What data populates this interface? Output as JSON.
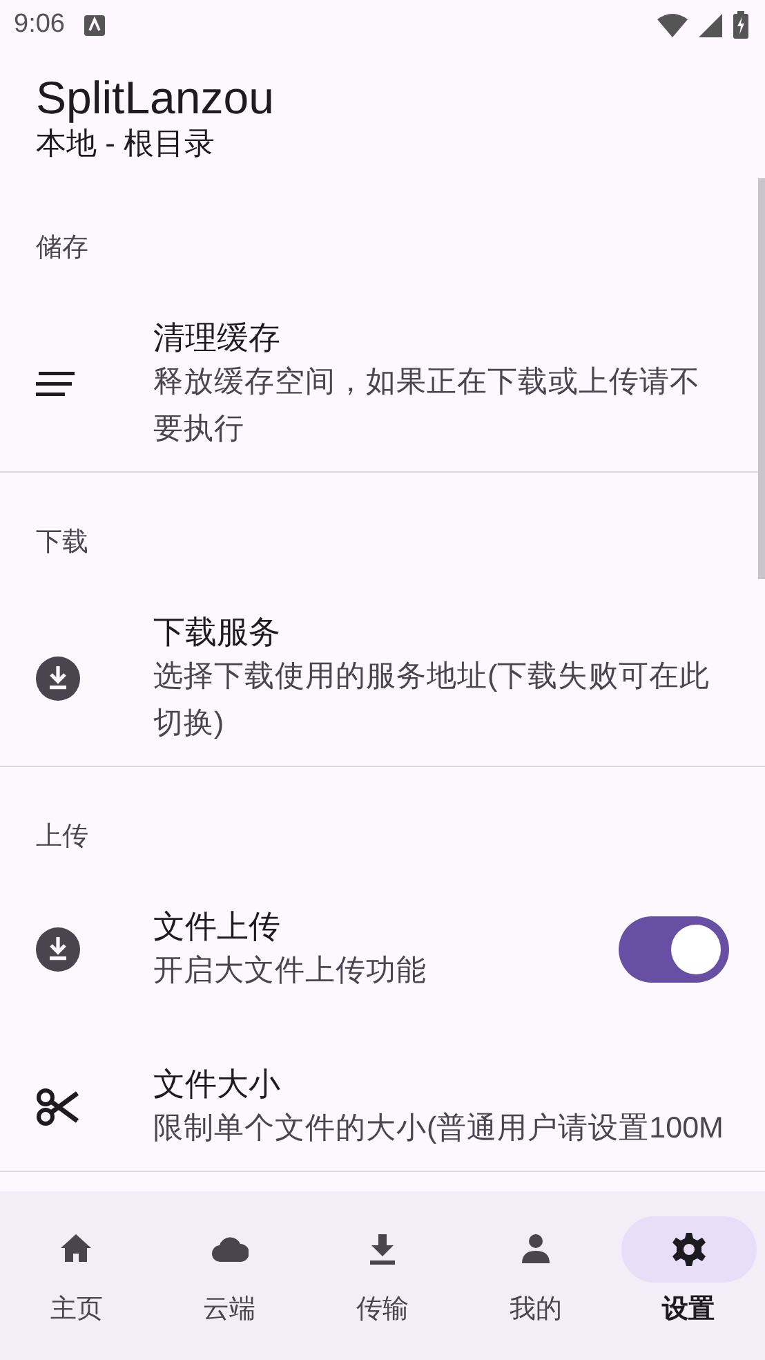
{
  "status_bar": {
    "time": "9:06"
  },
  "app_bar": {
    "title": "SplitLanzou",
    "subtitle": "本地 - 根目录"
  },
  "sections": [
    {
      "label": "储存",
      "items": [
        {
          "kind": "plain",
          "title": "清理缓存",
          "summary": "释放缓存空间，如果正在下载或上传请不要执行"
        }
      ]
    },
    {
      "label": "下载",
      "items": [
        {
          "kind": "plain",
          "title": "下载服务",
          "summary": "选择下载使用的服务地址(下载失败可在此切换)"
        }
      ]
    },
    {
      "label": "上传",
      "items": [
        {
          "kind": "switch",
          "title": "文件上传",
          "summary": "开启大文件上传功能",
          "on": true
        },
        {
          "kind": "plain",
          "title": "文件大小",
          "summary": "限制单个文件的大小(普通用户请设置100M"
        }
      ]
    }
  ],
  "bottom_nav": [
    {
      "label": "主页",
      "selected": false
    },
    {
      "label": "云端",
      "selected": false
    },
    {
      "label": "传输",
      "selected": false
    },
    {
      "label": "我的",
      "selected": false
    },
    {
      "label": "设置",
      "selected": true
    }
  ]
}
